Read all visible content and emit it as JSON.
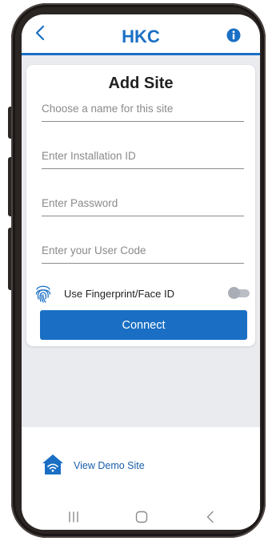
{
  "header": {
    "logo": "HKC",
    "back_icon": "chevron-left-icon",
    "info_icon": "info-icon",
    "accent": "#1a6fc4"
  },
  "form": {
    "title": "Add Site",
    "site_name_placeholder": "Choose a name for this site",
    "installation_id_placeholder": "Enter Installation ID",
    "password_placeholder": "Enter Password",
    "user_code_placeholder": "Enter your User Code",
    "fingerprint_label": "Use Fingerprint/Face ID",
    "fingerprint_enabled": false,
    "connect_label": "Connect"
  },
  "demo": {
    "label": "View Demo Site",
    "icon": "home-wifi-icon"
  },
  "system_nav": {
    "recents_icon": "recents-icon",
    "home_icon": "home-icon",
    "back_icon": "back-icon"
  }
}
